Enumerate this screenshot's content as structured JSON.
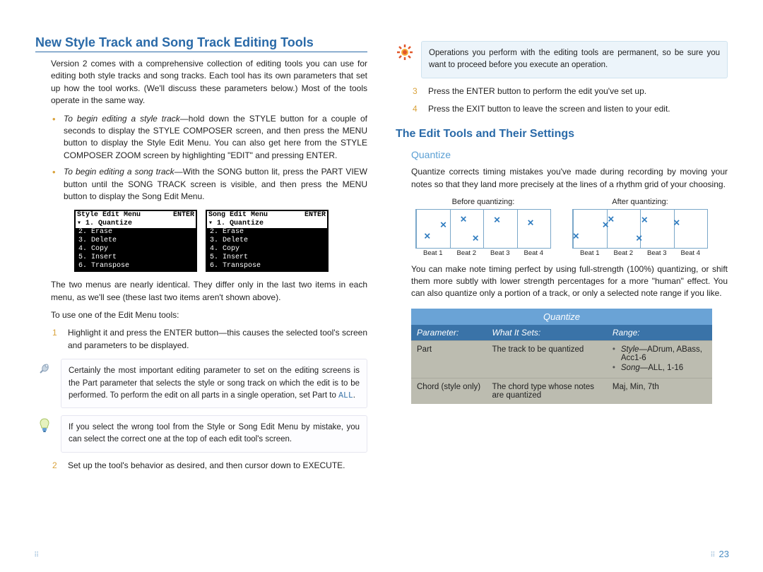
{
  "left": {
    "h1": "New Style Track and Song Track Editing Tools",
    "intro": "Version 2 comes with a comprehensive collection of editing tools you can use for editing both style tracks and song tracks. Each tool has its own parameters that set up how the tool works. (We'll discuss these parameters below.) Most of the tools operate in the same way.",
    "bullet1_lead": "To begin editing a style track",
    "bullet1_body": "—hold down the STYLE button for a couple of seconds to display the STYLE COMPOSER screen, and then press the MENU button to display the Style Edit Menu. You can also get here from the STYLE COMPOSER ZOOM screen by highlighting \"EDIT\" and pressing ENTER.",
    "bullet2_lead": "To begin editing a song track",
    "bullet2_body": "—With the SONG button lit, press the PART VIEW button until the SONG TRACK screen is visible, and then press the MENU button to display the Song Edit Menu.",
    "lcd1": {
      "title": "Style Edit Menu",
      "btn": "ENTER",
      "first": "▾ 1. Quantize",
      "items": [
        "2. Erase",
        "3. Delete",
        "4. Copy",
        "5. Insert",
        "6. Transpose"
      ]
    },
    "lcd2": {
      "title": "Song Edit Menu",
      "btn": "ENTER",
      "first": "▾ 1. Quantize",
      "items": [
        "2. Erase",
        "3. Delete",
        "4. Copy",
        "5. Insert",
        "6. Transpose"
      ]
    },
    "menus_note": "The two menus are nearly identical. They differ only in the last two items in each menu, as we'll see (these last two items aren't shown above).",
    "to_use": "To use one of the Edit Menu tools:",
    "step1_num": "1",
    "step1": "Highlight it and press the ENTER button—this causes the selected tool's screen and parameters to be displayed.",
    "note_pin": "Certainly the most important editing parameter to set on the editing screens is the Part parameter that selects the style or song track on which the edit is to be performed. To perform the edit on all parts in a single operation, set Part to ",
    "note_pin_all": "ALL",
    "note_pin_tail": ".",
    "note_bulb": "If you select the wrong tool from the Style or Song Edit Menu by mistake, you can select the correct one at the top of each edit tool's screen.",
    "step2_num": "2",
    "step2": "Set up the tool's behavior as desired, and then cursor down to EXECUTE."
  },
  "right": {
    "warn": "Operations you perform with the editing tools are permanent, so be sure you want to proceed before you execute an operation.",
    "step3_num": "3",
    "step3": "Press the ENTER button to perform the edit you've set up.",
    "step4_num": "4",
    "step4": "Press the EXIT button to leave the screen and listen to your edit.",
    "h2": "The Edit Tools and Their Settings",
    "h3": "Quantize",
    "qz_intro": "Quantize corrects timing mistakes you've made during recording by moving your notes so that they land more precisely at the lines of a rhythm grid of your choosing.",
    "before_cap": "Before quantizing:",
    "after_cap": "After quantizing:",
    "beat_labels": [
      "Beat 1",
      "Beat 2",
      "Beat 3",
      "Beat 4"
    ],
    "qz_body": "You can make note timing perfect by using full-strength (100%) quantizing, or shift them more subtly with lower strength percentages for a more \"human\" effect. You can also quantize only a portion of a track, or only a selected note range if you like.",
    "table": {
      "title": "Quantize",
      "headers": [
        "Parameter:",
        "What It Sets:",
        "Range:"
      ],
      "rows": [
        {
          "param": "Part",
          "what": "The track to be quantized",
          "range_items": [
            {
              "lead": "Style",
              "body": "—ADrum, ABass, Acc1-6"
            },
            {
              "lead": "Song",
              "body": "—ALL, 1-16"
            }
          ]
        },
        {
          "param": "Chord (style only)",
          "what": "The chord type whose notes are quantized",
          "range_text": "Maj, Min, 7th"
        }
      ]
    }
  },
  "page_number": "23"
}
